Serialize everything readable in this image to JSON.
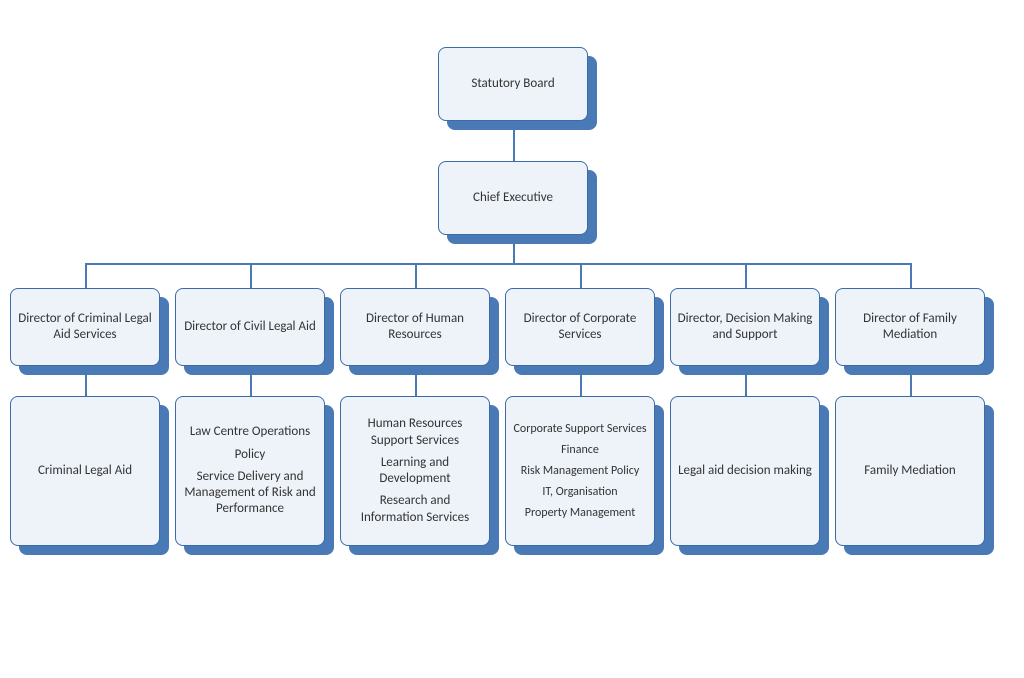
{
  "chart_data": {
    "type": "org-chart",
    "root": {
      "label": "Statutory Board",
      "children": [
        {
          "label": "Chief Executive",
          "children": [
            {
              "label": "Director of Criminal Legal Aid Services",
              "children": [
                {
                  "label": [
                    "Criminal Legal Aid"
                  ]
                }
              ]
            },
            {
              "label": "Director of Civil Legal Aid",
              "children": [
                {
                  "label": [
                    "Law Centre Operations",
                    "Policy",
                    "Service Delivery and Management of Risk and Performance"
                  ]
                }
              ]
            },
            {
              "label": "Director of Human Resources",
              "children": [
                {
                  "label": [
                    "Human Resources Support Services",
                    "Learning and Development",
                    "Research and Information Services"
                  ]
                }
              ]
            },
            {
              "label": "Director of Corporate Services",
              "children": [
                {
                  "label": [
                    "Corporate Support Services",
                    "Finance",
                    "Risk Management Policy",
                    "IT, Organisation",
                    "Property Management"
                  ]
                }
              ]
            },
            {
              "label": "Director, Decision Making and Support",
              "children": [
                {
                  "label": [
                    "Legal aid decision making"
                  ]
                }
              ]
            },
            {
              "label": "Director of Family Mediation",
              "children": [
                {
                  "label": [
                    "Family Mediation"
                  ]
                }
              ]
            }
          ]
        }
      ]
    }
  },
  "boxes": {
    "root": "Statutory Board",
    "ceo": "Chief Executive",
    "dir0": "Director of Criminal Legal Aid Services",
    "dir1": "Director of Civil Legal Aid",
    "dir2": "Director of Human Resources",
    "dir3": "Director of Corporate Services",
    "dir4": "Director, Decision Making and Support",
    "dir5": "Director of Family Mediation",
    "func0": {
      "0": "Criminal Legal Aid"
    },
    "func1": {
      "0": "Law Centre Operations",
      "1": "Policy",
      "2": "Service Delivery and Management of Risk and Performance"
    },
    "func2": {
      "0": "Human Resources Support Services",
      "1": "Learning and Development",
      "2": "Research and Information Services"
    },
    "func3": {
      "0": "Corporate Support Services",
      "1": "Finance",
      "2": "Risk Management Policy",
      "3": "IT, Organisation",
      "4": "Property Management"
    },
    "func4": {
      "0": "Legal aid decision making"
    },
    "func5": {
      "0": "Family Mediation"
    }
  }
}
